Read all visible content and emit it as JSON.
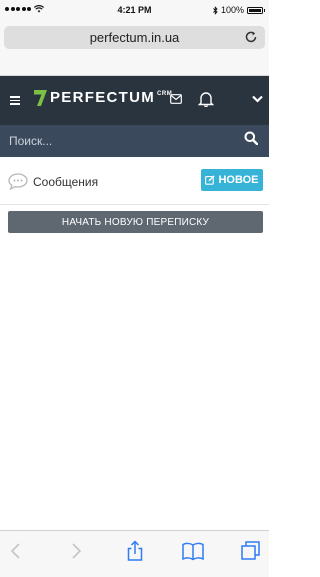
{
  "status_bar": {
    "time": "4:21 PM",
    "battery": "100%"
  },
  "browser": {
    "url": "perfectum.in.ua"
  },
  "header": {
    "brand": "PERFECTUM",
    "brand_suffix": "CRM"
  },
  "search": {
    "placeholder": "Поиск..."
  },
  "messages": {
    "title": "Сообщения",
    "new_label": "НОВОЕ",
    "start_label": "НАЧАТЬ НОВУЮ ПЕРЕПИСКУ"
  },
  "colors": {
    "header_bg": "#2a343f",
    "search_bg": "#3a4a5c",
    "new_button": "#36b3d6",
    "start_button": "#5f6771",
    "logo_green": "#7bc043",
    "ios_blue": "#2f7cf6"
  },
  "icons": {
    "menu": "hamburger-icon",
    "mail": "mail-icon",
    "notifications": "bell-icon",
    "dropdown": "chevron-down-icon",
    "search": "search-icon",
    "messages": "chat-bubble-icon",
    "edit": "edit-icon",
    "back": "back-arrow-icon",
    "forward": "forward-arrow-icon",
    "share": "share-icon",
    "bookmarks": "book-icon",
    "tabs": "tabs-icon"
  }
}
